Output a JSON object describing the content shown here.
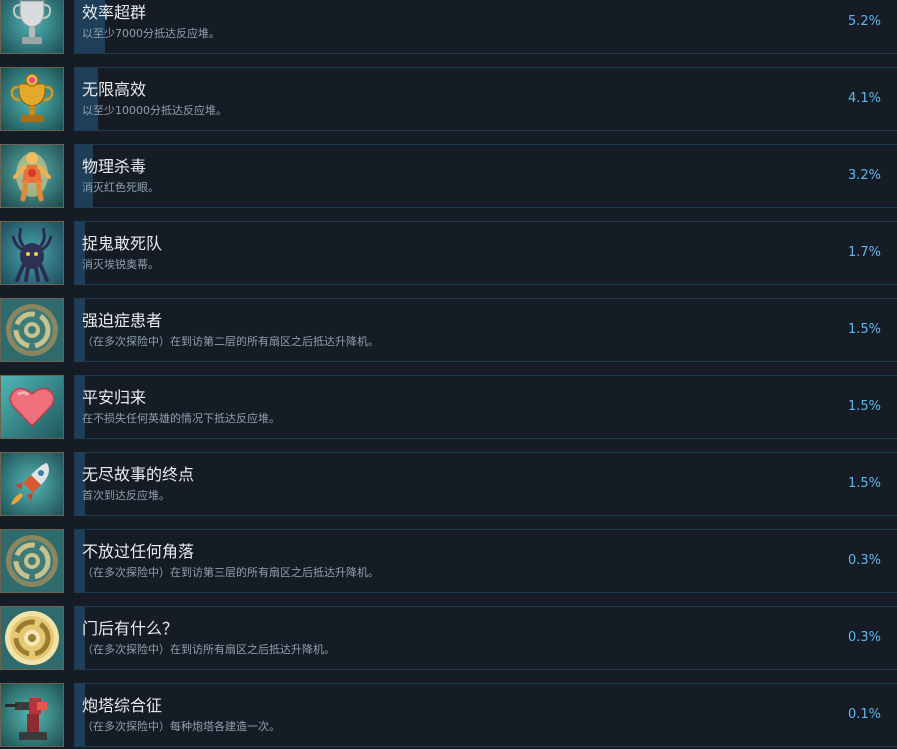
{
  "achievements": [
    {
      "title": "效率超群",
      "description": "以至少7000分抵达反应堆。",
      "percent": "5.2%",
      "unlock_rate": 0.052,
      "icon": "silver-trophy-icon"
    },
    {
      "title": "无限高效",
      "description": "以至少10000分抵达反应堆。",
      "percent": "4.1%",
      "unlock_rate": 0.041,
      "icon": "gold-trophy-icon"
    },
    {
      "title": "物理杀毒",
      "description": "消灭红色死眼。",
      "percent": "3.2%",
      "unlock_rate": 0.032,
      "icon": "fiery-figure-icon"
    },
    {
      "title": "捉鬼敢死队",
      "description": "消灭埃锐奥蒂。",
      "percent": "1.7%",
      "unlock_rate": 0.017,
      "icon": "tentacle-monster-icon"
    },
    {
      "title": "强迫症患者",
      "description": "（在多次探险中）在到访第二层的所有扇区之后抵达升降机。",
      "percent": "1.5%",
      "unlock_rate": 0.015,
      "icon": "floor-emblem-icon"
    },
    {
      "title": "平安归来",
      "description": "在不损失任何英雄的情况下抵达反应堆。",
      "percent": "1.5%",
      "unlock_rate": 0.015,
      "icon": "heart-icon"
    },
    {
      "title": "无尽故事的终点",
      "description": "首次到达反应堆。",
      "percent": "1.5%",
      "unlock_rate": 0.015,
      "icon": "rocket-icon"
    },
    {
      "title": "不放过任何角落",
      "description": "（在多次探险中）在到访第三层的所有扇区之后抵达升降机。",
      "percent": "0.3%",
      "unlock_rate": 0.003,
      "icon": "floor-emblem-icon"
    },
    {
      "title": "门后有什么？",
      "description": "（在多次探险中）在到访所有扇区之后抵达升降机。",
      "percent": "0.3%",
      "unlock_rate": 0.003,
      "icon": "gold-emblem-icon"
    },
    {
      "title": "炮塔综合征",
      "description": "（在多次探险中）每种炮塔各建造一次。",
      "percent": "0.1%",
      "unlock_rate": 0.001,
      "icon": "turret-icon"
    }
  ]
}
